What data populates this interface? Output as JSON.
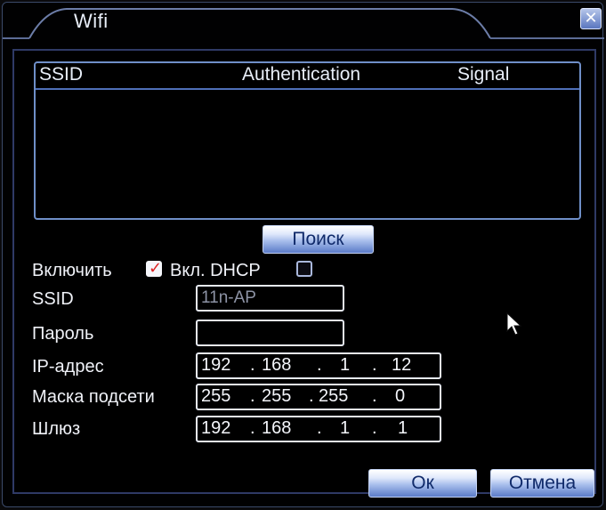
{
  "window": {
    "title": "Wifi",
    "close_icon": "close-x-icon",
    "accent": "#6f8fc8"
  },
  "list": {
    "columns": [
      "SSID",
      "Authentication",
      "Signal"
    ],
    "rows": []
  },
  "search_button": "Поиск",
  "enable": {
    "label": "Включить",
    "checked": true
  },
  "dhcp": {
    "label": "Вкл. DHCP",
    "checked": false
  },
  "fields": {
    "ssid": {
      "label": "SSID",
      "value": "11n-AP"
    },
    "password": {
      "label": "Пароль",
      "value": ""
    },
    "ip": {
      "label": "IP-адрес",
      "octets": [
        "192",
        "168",
        "1",
        "12"
      ]
    },
    "mask": {
      "label": "Маска подсети",
      "octets": [
        "255",
        "255",
        "255",
        "0"
      ]
    },
    "gateway": {
      "label": "Шлюз",
      "octets": [
        "192",
        "168",
        "1",
        "1"
      ]
    }
  },
  "buttons": {
    "ok": "Ок",
    "cancel": "Отмена"
  }
}
